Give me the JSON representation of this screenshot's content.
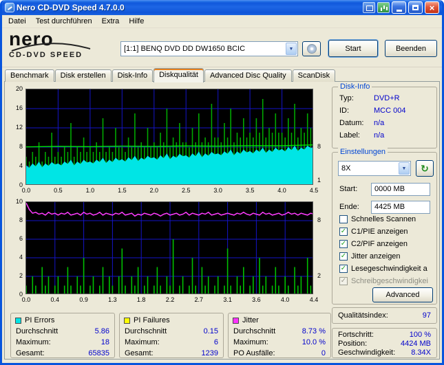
{
  "window": {
    "title": "Nero CD-DVD Speed 4.7.0.0"
  },
  "menubar": {
    "items": [
      "Datei",
      "Test durchführen",
      "Extra",
      "Hilfe"
    ]
  },
  "header": {
    "logo_main": "nero",
    "logo_sub": "CD-DVD SPEED",
    "drive_selector": "[1:1]  BENQ DVD DD DW1650 BCIC",
    "start_button": "Start",
    "quit_button": "Beenden"
  },
  "tabs": [
    {
      "label": "Benchmark",
      "active": false
    },
    {
      "label": "Disk erstellen",
      "active": false
    },
    {
      "label": "Disk-Info",
      "active": false
    },
    {
      "label": "Diskqualität",
      "active": true
    },
    {
      "label": "Advanced Disc Quality",
      "active": false
    },
    {
      "label": "ScanDisk",
      "active": false
    }
  ],
  "disk_info": {
    "title": "Disk-Info",
    "rows": [
      {
        "label": "Typ:",
        "value": "DVD+R"
      },
      {
        "label": "ID:",
        "value": "MCC 004"
      },
      {
        "label": "Datum:",
        "value": "n/a"
      },
      {
        "label": "Label:",
        "value": "n/a"
      }
    ]
  },
  "settings": {
    "title": "Einstellungen",
    "speed_select": "8X",
    "start_label": "Start:",
    "start_value": "0000 MB",
    "end_label": "Ende:",
    "end_value": "4425 MB",
    "checkboxes": [
      {
        "label": "Schnelles Scannen",
        "checked": false,
        "enabled": true
      },
      {
        "label": "C1/PIE anzeigen",
        "checked": true,
        "enabled": true
      },
      {
        "label": "C2/PIF anzeigen",
        "checked": true,
        "enabled": true
      },
      {
        "label": "Jitter anzeigen",
        "checked": true,
        "enabled": true
      },
      {
        "label": "Lesegeschwindigkeit a",
        "checked": true,
        "enabled": true
      },
      {
        "label": "Schreibgeschwindigkei",
        "checked": true,
        "enabled": false
      }
    ],
    "advanced_button": "Advanced"
  },
  "quality": {
    "label": "Qualitätsindex:",
    "value": "97"
  },
  "progress": {
    "rows": [
      {
        "label": "Fortschritt:",
        "value": "100 %"
      },
      {
        "label": "Position:",
        "value": "4424 MB"
      },
      {
        "label": "Geschwindigkeit:",
        "value": "8.34X"
      }
    ]
  },
  "stats": [
    {
      "title": "PI Errors",
      "swatch": "#00E5E5",
      "rows": [
        {
          "label": "Durchschnitt",
          "value": "5.86"
        },
        {
          "label": "Maximum:",
          "value": "18"
        },
        {
          "label": "Gesamt:",
          "value": "65835"
        }
      ]
    },
    {
      "title": "PI Failures",
      "swatch": "#FFFF00",
      "rows": [
        {
          "label": "Durchschnitt",
          "value": "0.15"
        },
        {
          "label": "Maximum:",
          "value": "6"
        },
        {
          "label": "Gesamt:",
          "value": "1239"
        }
      ]
    },
    {
      "title": "Jitter",
      "swatch": "#FF33FF",
      "rows": [
        {
          "label": "Durchschnitt",
          "value": "8.73 %"
        },
        {
          "label": "Maximum:",
          "value": "10.0 %"
        },
        {
          "label": "PO Ausfälle:",
          "value": "0"
        }
      ]
    }
  ],
  "icons": {
    "dropdown-arrow": "▼",
    "refresh": "↻",
    "check": "✓",
    "close": "×"
  },
  "chart_data": [
    {
      "type": "area",
      "title": "PI Errors vs. position (GB)",
      "xlim": [
        0,
        4.5
      ],
      "ylim": [
        0,
        20
      ],
      "xticks": [
        "0.0",
        "0.5",
        "1.0",
        "1.5",
        "2.0",
        "2.5",
        "3.0",
        "3.5",
        "4.0",
        "4.5"
      ],
      "yticks": [
        0,
        4,
        8,
        12,
        16,
        20
      ],
      "right_ticks": [
        {
          "label": "8",
          "value": 8
        },
        {
          "label": "1",
          "value": 1
        }
      ],
      "bg": "#000000",
      "grid": "#1414C8",
      "grid_on": true,
      "legend": "bottom boxes",
      "series": [
        {
          "name": "PIE max (spikes)",
          "type": "spikes",
          "color": "#00A800",
          "values": [
            6,
            5,
            7,
            6,
            9,
            5,
            7,
            6,
            11,
            6,
            7,
            6,
            8,
            7,
            13,
            6,
            8,
            7,
            10,
            7,
            8,
            7,
            9,
            7,
            14,
            7,
            8,
            7,
            12,
            8,
            8,
            7,
            10,
            8,
            15,
            8,
            9,
            8,
            12,
            8,
            9,
            8,
            11,
            9,
            16,
            8,
            10,
            9,
            13,
            9,
            9,
            8,
            12,
            9,
            15,
            9,
            10,
            9,
            17,
            10,
            10,
            9,
            13,
            10,
            16,
            9,
            11,
            10,
            14,
            10,
            11,
            10,
            14,
            11,
            18,
            10,
            12,
            11,
            15,
            11,
            11,
            10,
            14,
            11,
            17,
            10,
            12,
            11,
            15,
            12,
            12
          ]
        },
        {
          "name": "PIE average (area)",
          "type": "area",
          "color": "#00E5E5",
          "values": [
            4.2,
            3.7,
            4.6,
            4.0,
            5.0,
            3.8,
            4.6,
            4.1,
            4.9,
            4.4,
            4.6,
            4.2,
            5.0,
            4.5,
            5.4,
            4.2,
            5.0,
            4.5,
            5.4,
            4.8,
            5.0,
            4.6,
            5.4,
            4.9,
            5.8,
            4.7,
            5.4,
            4.9,
            5.8,
            5.2,
            5.5,
            5.0,
            5.9,
            5.3,
            6.2,
            5.1,
            5.8,
            5.4,
            6.2,
            5.7,
            5.9,
            5.4,
            6.3,
            5.7,
            6.7,
            5.5,
            6.2,
            5.8,
            6.6,
            6.1,
            6.3,
            5.8,
            6.7,
            6.1,
            7.1,
            5.9,
            6.7,
            6.2,
            7.0,
            6.5,
            6.7,
            6.3,
            7.1,
            6.6,
            7.5,
            6.3,
            7.1,
            6.6,
            7.5,
            6.9,
            7.2,
            6.7,
            7.5,
            7.0,
            7.9,
            6.8,
            7.5,
            7.0,
            7.9,
            7.3,
            7.6,
            7.1,
            8.0,
            7.4,
            8.3,
            7.2,
            7.9,
            7.5,
            8.3,
            7.8,
            8.0
          ]
        },
        {
          "name": "Lesegeschwindigkeit (X)",
          "type": "line",
          "color": "#00E600",
          "width": 1.4,
          "x": [
            0,
            0.5,
            1,
            1.5,
            2,
            2.5,
            3,
            3.5,
            4,
            4.5
          ],
          "values": [
            8.05,
            8.15,
            8.1,
            8.2,
            8.15,
            8.25,
            8.2,
            8.3,
            8.3,
            8.45
          ]
        }
      ]
    },
    {
      "type": "bar",
      "title": "PI Failures / Jitter vs. position (GB)",
      "xlim": [
        0,
        4.4
      ],
      "ylim": [
        0,
        10
      ],
      "xticks": [
        "0.0",
        "0.4",
        "0.9",
        "1.3",
        "1.8",
        "2.2",
        "2.7",
        "3.1",
        "3.6",
        "4.0",
        "4.4"
      ],
      "yticks": [
        0,
        2,
        4,
        6,
        8,
        10
      ],
      "right_ticks": [
        {
          "label": "8",
          "value": 8
        },
        {
          "label": "2",
          "value": 2
        }
      ],
      "bg": "#000000",
      "grid": "#1414C8",
      "grid_on": true,
      "legend": "bottom boxes",
      "series": [
        {
          "name": "PIF (spikes)",
          "type": "spikes",
          "color": "#00C000",
          "values": [
            1,
            0,
            2,
            1,
            0,
            3,
            1,
            2,
            0,
            1,
            2,
            0,
            1,
            3,
            1,
            0,
            2,
            1,
            4,
            0,
            1,
            2,
            0,
            1,
            3,
            0,
            2,
            1,
            0,
            2,
            5,
            1,
            0,
            2,
            1,
            3,
            0,
            1,
            2,
            0,
            1,
            3,
            1,
            0,
            2,
            1,
            6,
            0,
            1,
            2,
            0,
            1,
            4,
            1,
            0,
            3,
            1,
            2,
            0,
            1,
            2,
            0,
            1,
            5,
            1,
            0,
            2,
            1,
            3,
            0,
            1,
            2,
            0,
            4,
            1,
            2,
            0,
            1,
            3,
            1,
            0,
            2,
            1,
            0,
            3,
            1,
            2,
            0,
            4,
            1,
            2
          ]
        },
        {
          "name": "Jitter (%)",
          "type": "line",
          "color": "#FF3CFF",
          "width": 1.5,
          "values": [
            9.9,
            9.2,
            8.8,
            8.9,
            8.7,
            8.8,
            8.6,
            8.9,
            8.7,
            8.8,
            8.6,
            8.8,
            8.7,
            8.9,
            8.6,
            8.7,
            8.8,
            8.6,
            8.9,
            8.7,
            8.8,
            8.6,
            8.7,
            8.9,
            8.6,
            8.8,
            8.7,
            8.6,
            8.8,
            8.7,
            8.9,
            8.6,
            8.7,
            8.8,
            8.5,
            8.7,
            8.6,
            8.8,
            8.7,
            8.6,
            8.8,
            8.7,
            8.5,
            8.7,
            8.8,
            8.6,
            8.7,
            8.8,
            8.6,
            8.7,
            8.9,
            8.6,
            8.8,
            8.7,
            8.6,
            8.8,
            8.7,
            8.9,
            8.6,
            8.7,
            8.8,
            8.6,
            8.7,
            8.8,
            8.7,
            8.6,
            8.8,
            8.7,
            8.9,
            8.7,
            8.6,
            8.8,
            8.7,
            8.6,
            8.9,
            8.7,
            8.8,
            8.6,
            8.7,
            8.8,
            8.6,
            8.7,
            8.9,
            8.7,
            8.8,
            8.6,
            8.8,
            8.7,
            8.6,
            8.8,
            8.7
          ]
        }
      ]
    }
  ]
}
